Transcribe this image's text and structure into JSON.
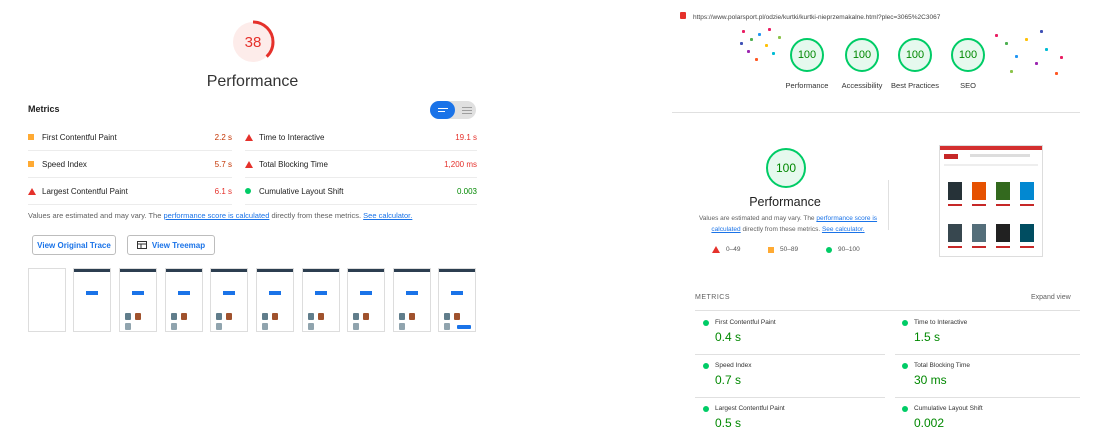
{
  "left": {
    "score": "38",
    "title": "Performance",
    "metrics_heading": "Metrics",
    "metrics": [
      {
        "label": "First Contentful Paint",
        "value": "2.2 s",
        "status": "average"
      },
      {
        "label": "Time to Interactive",
        "value": "19.1 s",
        "status": "fail"
      },
      {
        "label": "Speed Index",
        "value": "5.7 s",
        "status": "average"
      },
      {
        "label": "Total Blocking Time",
        "value": "1,200 ms",
        "status": "fail"
      },
      {
        "label": "Largest Contentful Paint",
        "value": "6.1 s",
        "status": "fail"
      },
      {
        "label": "Cumulative Layout Shift",
        "value": "0.003",
        "status": "pass"
      }
    ],
    "note_prefix": "Values are estimated and may vary. The ",
    "note_link1": "performance score is calculated",
    "note_mid": " directly from these metrics. ",
    "note_link2": "See calculator.",
    "btn_trace": "View Original Trace",
    "btn_treemap": "View Treemap"
  },
  "right": {
    "url": "https://www.polarsport.pl/odzie/kurtki/kurtki-nieprzemakalne.html?plec=3065%2C3067",
    "gauges": [
      {
        "score": "100",
        "label": "Performance"
      },
      {
        "score": "100",
        "label": "Accessibility"
      },
      {
        "score": "100",
        "label": "Best Practices"
      },
      {
        "score": "100",
        "label": "SEO"
      }
    ],
    "perf_score": "100",
    "perf_title": "Performance",
    "note_prefix": "Values are estimated and may vary. The ",
    "note_link1": "performance score is calculated",
    "note_mid": " directly from these metrics. ",
    "note_link2": "See calculator.",
    "legend": [
      "0–49",
      "50–89",
      "90–100"
    ],
    "metrics_heading": "METRICS",
    "expand": "Expand view",
    "metrics": [
      {
        "label": "First Contentful Paint",
        "value": "0.4 s"
      },
      {
        "label": "Time to Interactive",
        "value": "1.5 s"
      },
      {
        "label": "Speed Index",
        "value": "0.7 s"
      },
      {
        "label": "Total Blocking Time",
        "value": "30 ms"
      },
      {
        "label": "Largest Contentful Paint",
        "value": "0.5 s"
      },
      {
        "label": "Cumulative Layout Shift",
        "value": "0.002"
      }
    ]
  },
  "colors": {
    "fail": "#e5312b",
    "average": "#ffaa33",
    "pass": "#00cc66",
    "link": "#1a73e8"
  }
}
